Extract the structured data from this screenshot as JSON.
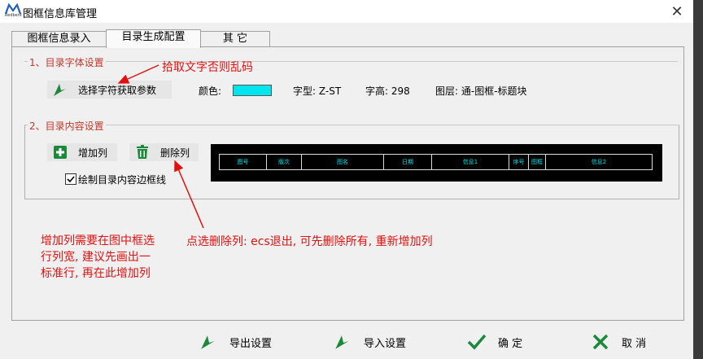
{
  "window": {
    "title": "图框信息库管理",
    "logo_text": "Redbent",
    "close_label": "✕"
  },
  "tabs": [
    {
      "label": "图框信息录入",
      "active": false
    },
    {
      "label": "目录生成配置",
      "active": true
    },
    {
      "label": "其  它",
      "active": false
    }
  ],
  "font_group": {
    "label": "1、目录字体设置",
    "pick_button": "选择字符获取参数",
    "color_label": "颜色:",
    "color_value": "#00e5ee",
    "font_label": "字型: Z-ST",
    "height_label": "字高: 298",
    "layer_label": "图层: 通-图框-标题块"
  },
  "content_group": {
    "label": "2、目录内容设置",
    "add_button": "增加列",
    "delete_button": "删除列",
    "checkbox_label": "绘制目录内容边框线",
    "checkbox_checked": true,
    "columns": [
      "图号",
      "版次",
      "图名",
      "日期",
      "信息1",
      "序号",
      "图框",
      "信息2"
    ]
  },
  "annotations": {
    "pick_hint": "拾取文字否则乱码",
    "delete_hint": "点选删除列: ecs退出, 可先删除所有, 重新增加列",
    "add_hint": "增加列需要在图中框选行列宽, 建议先画出一标准行, 再在此增加列"
  },
  "bottom_buttons": {
    "export": "导出设置",
    "import": "导入设置",
    "ok": "确  定",
    "cancel": "取  消"
  },
  "colors": {
    "accent_green": "#1a8a3a",
    "annotation_red": "#e01010",
    "swatch_cyan": "#00e5ee"
  }
}
